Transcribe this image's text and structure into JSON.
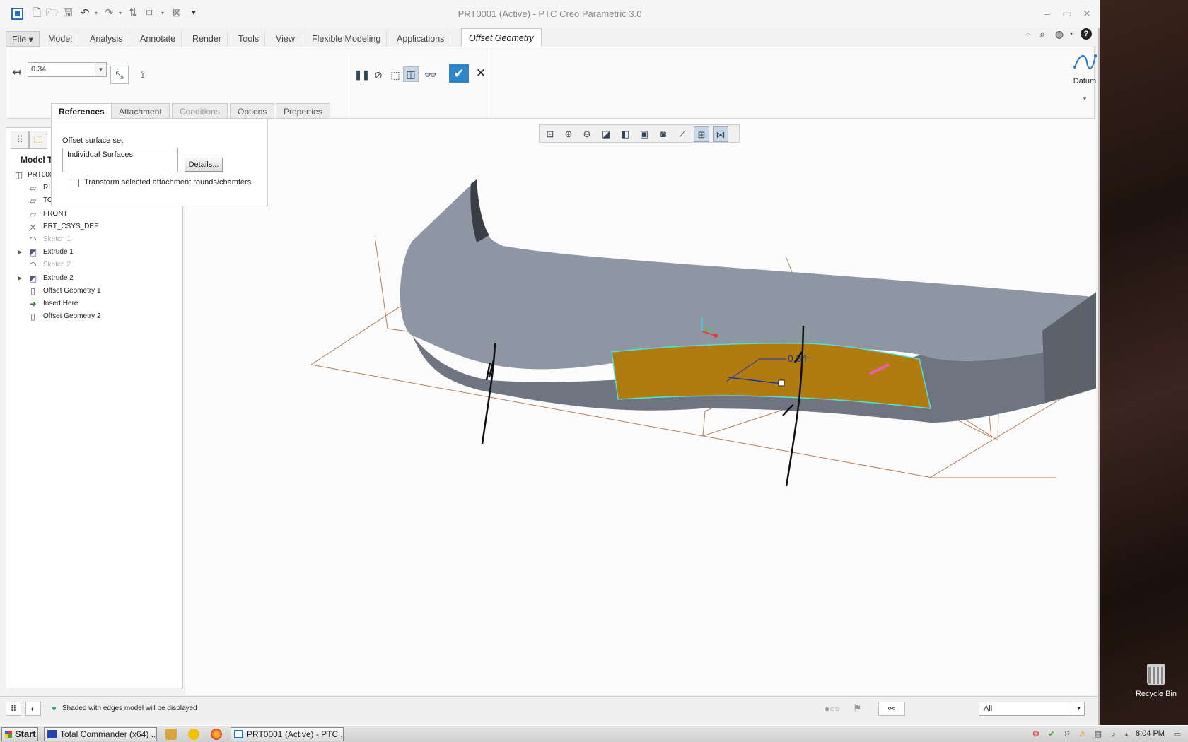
{
  "window": {
    "title": "PRT0001 (Active) - PTC Creo Parametric 3.0"
  },
  "ribbon_tabs": [
    {
      "label": "File ▾"
    },
    {
      "label": "Model"
    },
    {
      "label": "Analysis"
    },
    {
      "label": "Annotate"
    },
    {
      "label": "Render"
    },
    {
      "label": "Tools"
    },
    {
      "label": "View"
    },
    {
      "label": "Flexible Modeling"
    },
    {
      "label": "Applications"
    },
    {
      "label": "Offset Geometry"
    }
  ],
  "dashboard": {
    "offset_value": "0.34",
    "datum_label": "Datum",
    "subtabs": [
      {
        "label": "References",
        "state": "active"
      },
      {
        "label": "Attachment",
        "state": "normal"
      },
      {
        "label": "Conditions",
        "state": "disabled"
      },
      {
        "label": "Options",
        "state": "normal"
      },
      {
        "label": "Properties",
        "state": "normal"
      }
    ],
    "references_panel": {
      "set_label": "Offset surface set",
      "collector_value": "Individual Surfaces",
      "details_button": "Details...",
      "checkbox_label": "Transform selected attachment rounds/chamfers",
      "checkbox_checked": false
    }
  },
  "model_tree": {
    "title": "Model T",
    "items": [
      {
        "label": "PRT000",
        "icon": "part-icon",
        "expandable": false,
        "dim": false
      },
      {
        "label": "RI",
        "icon": "datum-plane-icon",
        "expandable": false,
        "dim": false
      },
      {
        "label": "TO",
        "icon": "datum-plane-icon",
        "expandable": false,
        "dim": false
      },
      {
        "label": "FRONT",
        "icon": "datum-plane-icon",
        "expandable": false,
        "dim": false
      },
      {
        "label": "PRT_CSYS_DEF",
        "icon": "csys-icon",
        "expandable": false,
        "dim": false
      },
      {
        "label": "Sketch 1",
        "icon": "sketch-icon",
        "expandable": false,
        "dim": true
      },
      {
        "label": "Extrude 1",
        "icon": "extrude-icon",
        "expandable": true,
        "dim": false
      },
      {
        "label": "Sketch 2",
        "icon": "sketch-icon",
        "expandable": false,
        "dim": true
      },
      {
        "label": "Extrude 2",
        "icon": "extrude-icon",
        "expandable": true,
        "dim": false
      },
      {
        "label": "Offset Geometry 1",
        "icon": "offset-icon",
        "expandable": false,
        "dim": false
      },
      {
        "label": "Insert Here",
        "icon": "insert-arrow-icon",
        "expandable": false,
        "dim": false
      },
      {
        "label": "Offset Geometry 2",
        "icon": "offset-icon",
        "expandable": false,
        "dim": false
      }
    ]
  },
  "graphics": {
    "dimension_label": "0.34",
    "highlight_color": "#b07c10",
    "model_color": "#8c93a0"
  },
  "status_bar": {
    "message": "Shaded with edges model will be displayed",
    "filter_value": "All"
  },
  "desktop": {
    "recycle_bin": "Recycle Bin"
  },
  "taskbar": {
    "start": "Start",
    "tasks": [
      {
        "label": "Total Commander (x64) ..."
      },
      {
        "label": "PRT0001 (Active) - PTC ..."
      }
    ],
    "clock": "8:04 PM"
  }
}
